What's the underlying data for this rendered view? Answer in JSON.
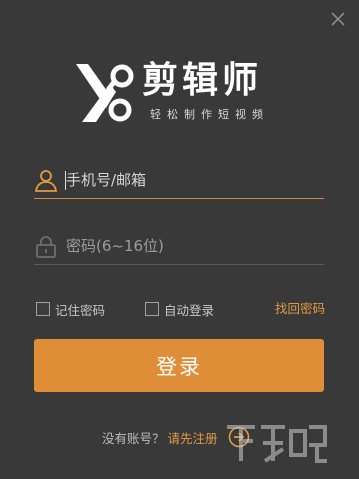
{
  "app": {
    "name": "剪辑师",
    "slogan": "轻松制作短视频"
  },
  "login_form": {
    "username_placeholder": "手机号/邮箱",
    "password_placeholder": "密码(6~16位)",
    "remember_password_label": "记住密码",
    "auto_login_label": "自动登录",
    "find_password_label": "找回密码",
    "login_button_label": "登录"
  },
  "register": {
    "question": "没有账号？",
    "link_label": "请先注册"
  },
  "icons": {
    "close": "close-icon",
    "user": "user-icon",
    "lock": "lock-icon",
    "arrow": "arrow-right-circle-icon"
  },
  "colors": {
    "background": "#393939",
    "accent": "#df8d36",
    "link": "#e39a43"
  }
}
